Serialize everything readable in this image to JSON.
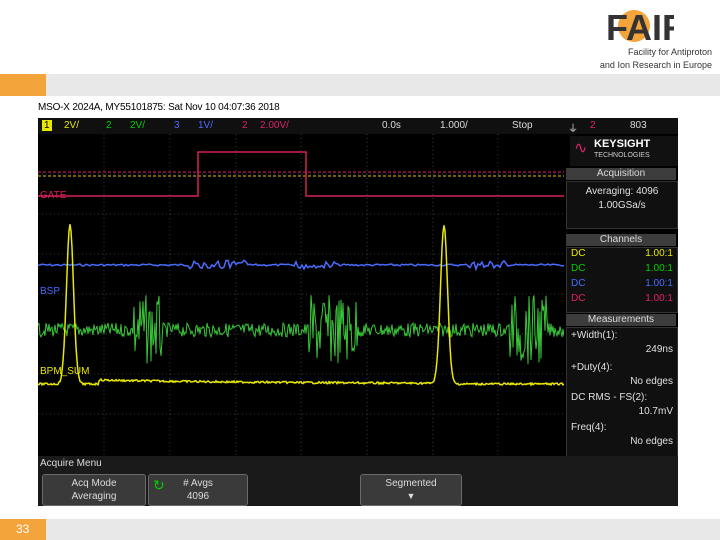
{
  "slide": {
    "logo_text": "FAIR",
    "subtitle_line1": "Facility for Antiproton",
    "subtitle_line2": "and Ion Research in Europe",
    "page_number": "33"
  },
  "scope": {
    "title": "MSO-X 2024A, MY55101875: Sat Nov 10 04:07:36 2018",
    "topbar": {
      "ch1_num": "1",
      "ch1_scale": "2V/",
      "ch2_num": "2",
      "ch2_scale": "2V/",
      "ch3_num": "3",
      "ch3_scale": "1V/",
      "trig_num": "2",
      "trig_scale": "2.00V/",
      "delay": "0.0s",
      "timebase": "1.000/",
      "run_state": "Stop",
      "trig_src": "2",
      "trig_level": "803"
    },
    "labels": {
      "gate": "GATE",
      "bsp": "BSP",
      "bpm": "BPM_SUM"
    },
    "panel": {
      "brand": "KEYSIGHT",
      "brand_sub": "TECHNOLOGIES",
      "acquisition_head": "Acquisition",
      "averaging": "Averaging: 4096",
      "sample_rate": "1.00GSa/s",
      "channels_head": "Channels",
      "channels": [
        {
          "coupling": "DC",
          "value": "1.00:1",
          "color": "#e8e800"
        },
        {
          "coupling": "DC",
          "value": "1.00:1",
          "color": "#00d000"
        },
        {
          "coupling": "DC",
          "value": "1.00:1",
          "color": "#4a6cff"
        },
        {
          "coupling": "DC",
          "value": "1.00:1",
          "color": "#e0206a"
        }
      ],
      "measurements_head": "Measurements",
      "m1_label": "+Width(1):",
      "m1_value": "249ns",
      "m2_label": "+Duty(4):",
      "m2_value": "No edges",
      "m3_label": "DC RMS - FS(2):",
      "m3_value": "10.7mV",
      "m4_label": "Freq(4):",
      "m4_value": "No edges"
    },
    "softkeys": {
      "menu_title": "Acquire Menu",
      "acq_mode_label": "Acq Mode",
      "acq_mode_value": "Averaging",
      "avgs_label": "# Avgs",
      "avgs_value": "4096",
      "segmented": "Segmented"
    }
  },
  "colors": {
    "ch1": "#e8e800",
    "ch2": "#38c838",
    "ch3": "#4a6cff",
    "ch4": "#d8205a",
    "accent": "#f3a43a"
  }
}
